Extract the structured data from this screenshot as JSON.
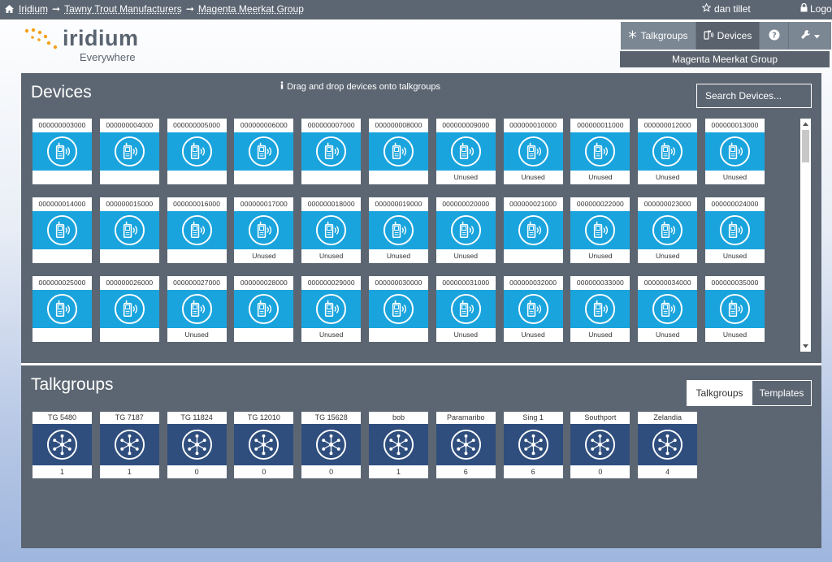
{
  "topbar": {
    "breadcrumbs": [
      "Iridium",
      "Tawny Trout Manufacturers",
      "Magenta Meerkat Group"
    ],
    "separator": "➞",
    "user": "dan tillet",
    "logout": "Logout"
  },
  "logo": {
    "wordmark": "iridium",
    "tagline": "Everywhere"
  },
  "nav": {
    "talkgroups": "Talkgroups",
    "devices": "Devices",
    "active_group": "Magenta Meerkat Group"
  },
  "devices": {
    "heading": "Devices",
    "hint": "Drag and drop devices onto talkgroups",
    "search_placeholder": "Search Devices...",
    "items": [
      {
        "id": "000000003000",
        "status": ""
      },
      {
        "id": "000000004000",
        "status": ""
      },
      {
        "id": "000000005000",
        "status": ""
      },
      {
        "id": "000000006000",
        "status": ""
      },
      {
        "id": "000000007000",
        "status": ""
      },
      {
        "id": "000000008000",
        "status": ""
      },
      {
        "id": "000000009000",
        "status": "Unused"
      },
      {
        "id": "000000010000",
        "status": "Unused"
      },
      {
        "id": "000000011000",
        "status": "Unused"
      },
      {
        "id": "000000012000",
        "status": "Unused"
      },
      {
        "id": "000000013000",
        "status": "Unused"
      },
      {
        "id": "000000014000",
        "status": ""
      },
      {
        "id": "000000015000",
        "status": ""
      },
      {
        "id": "000000016000",
        "status": ""
      },
      {
        "id": "000000017000",
        "status": "Unused"
      },
      {
        "id": "000000018000",
        "status": "Unused"
      },
      {
        "id": "000000019000",
        "status": "Unused"
      },
      {
        "id": "000000020000",
        "status": "Unused"
      },
      {
        "id": "000000021000",
        "status": ""
      },
      {
        "id": "000000022000",
        "status": "Unused"
      },
      {
        "id": "000000023000",
        "status": "Unused"
      },
      {
        "id": "000000024000",
        "status": "Unused"
      },
      {
        "id": "000000025000",
        "status": ""
      },
      {
        "id": "000000026000",
        "status": ""
      },
      {
        "id": "000000027000",
        "status": "Unused"
      },
      {
        "id": "000000028000",
        "status": ""
      },
      {
        "id": "000000029000",
        "status": "Unused"
      },
      {
        "id": "000000030000",
        "status": ""
      },
      {
        "id": "000000031000",
        "status": "Unused"
      },
      {
        "id": "000000032000",
        "status": "Unused"
      },
      {
        "id": "000000033000",
        "status": "Unused"
      },
      {
        "id": "000000034000",
        "status": "Unused"
      },
      {
        "id": "000000035000",
        "status": "Unused"
      }
    ]
  },
  "talkgroups": {
    "heading": "Talkgroups",
    "toggle_talkgroups": "Talkgroups",
    "toggle_templates": "Templates",
    "items": [
      {
        "name": "TG 5480",
        "count": "1"
      },
      {
        "name": "TG 7187",
        "count": "1"
      },
      {
        "name": "TG 11824",
        "count": "0"
      },
      {
        "name": "TG 12010",
        "count": "0"
      },
      {
        "name": "TG 15628",
        "count": "0"
      },
      {
        "name": "bob",
        "count": "1"
      },
      {
        "name": "Paramaribo",
        "count": "6"
      },
      {
        "name": "Sing 1",
        "count": "6"
      },
      {
        "name": "Southport",
        "count": "0"
      },
      {
        "name": "Zelandia",
        "count": "4"
      }
    ]
  },
  "colors": {
    "device_tile": "#1aa4dd",
    "talkgroup_tile": "#2f4e7e",
    "panel": "#5c6672",
    "topbar": "#5c6672"
  }
}
